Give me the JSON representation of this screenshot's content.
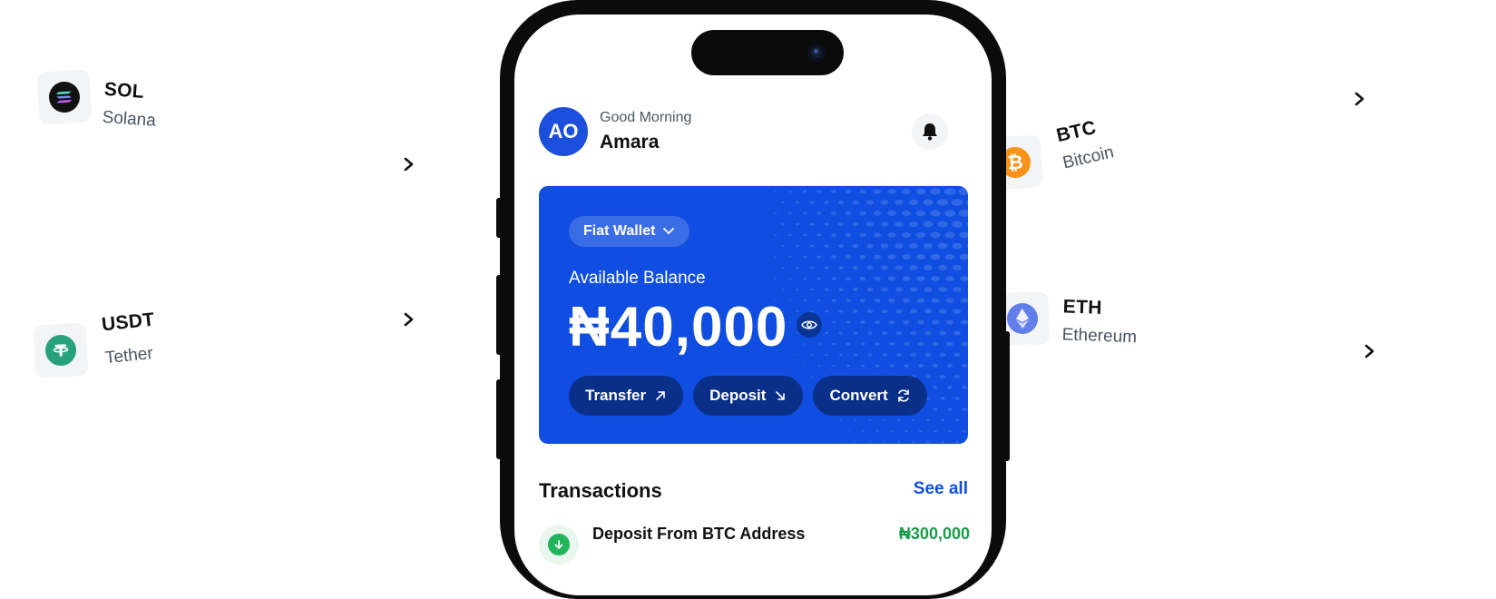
{
  "coins": [
    {
      "id": "sol",
      "symbol": "SOL",
      "name": "Solana",
      "icon": "solana-icon",
      "color": "#111111"
    },
    {
      "id": "usdt",
      "symbol": "USDT",
      "name": "Tether",
      "icon": "tether-icon",
      "color": "#26a17b"
    },
    {
      "id": "btc",
      "symbol": "BTC",
      "name": "Bitcoin",
      "icon": "bitcoin-icon",
      "color": "#f7931a"
    },
    {
      "id": "eth",
      "symbol": "ETH",
      "name": "Ethereum",
      "icon": "ethereum-icon",
      "color": "#627eea"
    }
  ],
  "header": {
    "avatar_initials": "AO",
    "greeting": "Good Morning",
    "user_name": "Amara"
  },
  "balance_card": {
    "wallet_selector": "Fiat Wallet",
    "label": "Available Balance",
    "amount": "₦40,000",
    "actions": [
      {
        "label": "Transfer",
        "icon": "arrow-up-right-icon"
      },
      {
        "label": "Deposit",
        "icon": "arrow-down-right-icon"
      },
      {
        "label": "Convert",
        "icon": "refresh-icon"
      }
    ]
  },
  "transactions": {
    "title": "Transactions",
    "see_all": "See all",
    "items": [
      {
        "label": "Deposit From BTC Address",
        "amount": "₦300,000",
        "icon": "arrow-down-icon"
      }
    ]
  },
  "colors": {
    "accent": "#0f4ee0",
    "success": "#1a9c4a"
  }
}
